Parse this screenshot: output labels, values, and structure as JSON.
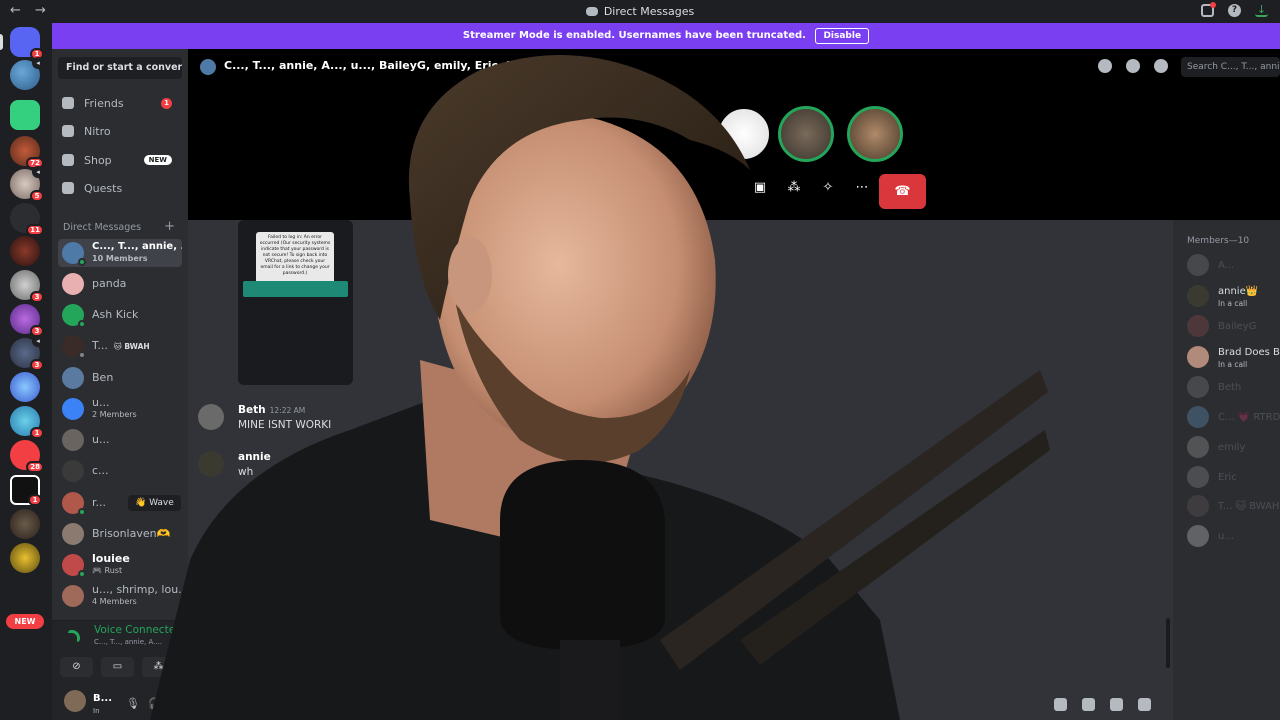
{
  "window": {
    "title": "Direct Messages",
    "back_glyph": "←",
    "forward_glyph": "→"
  },
  "banner": {
    "text": "Streamer Mode is enabled. Usernames have been truncated.",
    "button": "Disable",
    "color": "#7b3ff2"
  },
  "rail": {
    "new_label": "NEW",
    "badges": [
      "1",
      "72",
      "5",
      "11",
      "3",
      "3",
      "3",
      "1",
      "28",
      "1"
    ]
  },
  "sidebar": {
    "search_placeholder": "Find or start a convers...",
    "nav": [
      {
        "label": "Friends",
        "badge": "1",
        "icon": "friends-icon"
      },
      {
        "label": "Nitro",
        "icon": "nitro-icon"
      },
      {
        "label": "Shop",
        "tag": "NEW",
        "icon": "shop-icon"
      },
      {
        "label": "Quests",
        "icon": "quests-icon"
      }
    ],
    "dm_header": "Direct Messages",
    "dm_add": "+",
    "dms": [
      {
        "name": "C..., T..., annie, ...",
        "sub": "10 Members"
      },
      {
        "name": "panda"
      },
      {
        "name": "Ash Kick"
      },
      {
        "name": "T...",
        "tag": "🐱 BWAH"
      },
      {
        "name": "Ben"
      },
      {
        "name": "u...",
        "sub": "2 Members"
      },
      {
        "name": "u..."
      },
      {
        "name": "c..."
      },
      {
        "name": "r...",
        "wave": "👋 Wave"
      },
      {
        "name": "Brisonlaven🫶"
      },
      {
        "name": "louiee",
        "sub": "🎮 Rust"
      },
      {
        "name": "u..., shrimp, lou...",
        "sub": "4 Members"
      }
    ]
  },
  "voice": {
    "status": "Voice Connected",
    "channel": "C..., T..., annie, A....",
    "buttons": [
      "⊘",
      "▭",
      "⁂",
      "✦"
    ]
  },
  "user": {
    "name": "B...",
    "status": "In"
  },
  "chat": {
    "header_name": "C..., T..., annie, A..., u..., BaileyG, emily, Eric, Beth",
    "search_placeholder": "Search C..., T..., annie...",
    "image_text": "Failed to log in: An error occurred (Our security systems indicate that your password is not secure! To sign back into VRChat, please check your email for a link to change your password.)",
    "messages": [
      {
        "author": "Beth",
        "time": "12:22 AM",
        "text": "MINE ISNT WORKI"
      },
      {
        "author": "annie",
        "time": "",
        "text": "wh"
      }
    ]
  },
  "call": {
    "buttons": [
      "▣",
      "⁂",
      "✧",
      "⋯"
    ],
    "hangup": "☎"
  },
  "members": {
    "header": "Members—10",
    "list": [
      {
        "name": "A...",
        "offline": true
      },
      {
        "name": "annie👑",
        "status": "In a call"
      },
      {
        "name": "BaileyG",
        "offline": true
      },
      {
        "name": "Brad Does Ba",
        "status": "In a call"
      },
      {
        "name": "Beth",
        "offline": true
      },
      {
        "name": "C...  💗 RTRD",
        "offline": true
      },
      {
        "name": "emily",
        "offline": true
      },
      {
        "name": "Eric",
        "offline": true
      },
      {
        "name": "T...  🐱 BWAH",
        "offline": true
      },
      {
        "name": "u...",
        "offline": true
      }
    ]
  },
  "colors": {
    "accent_green": "#23a55a",
    "danger_red": "#da373c",
    "banner_purple": "#7b3ff2"
  }
}
